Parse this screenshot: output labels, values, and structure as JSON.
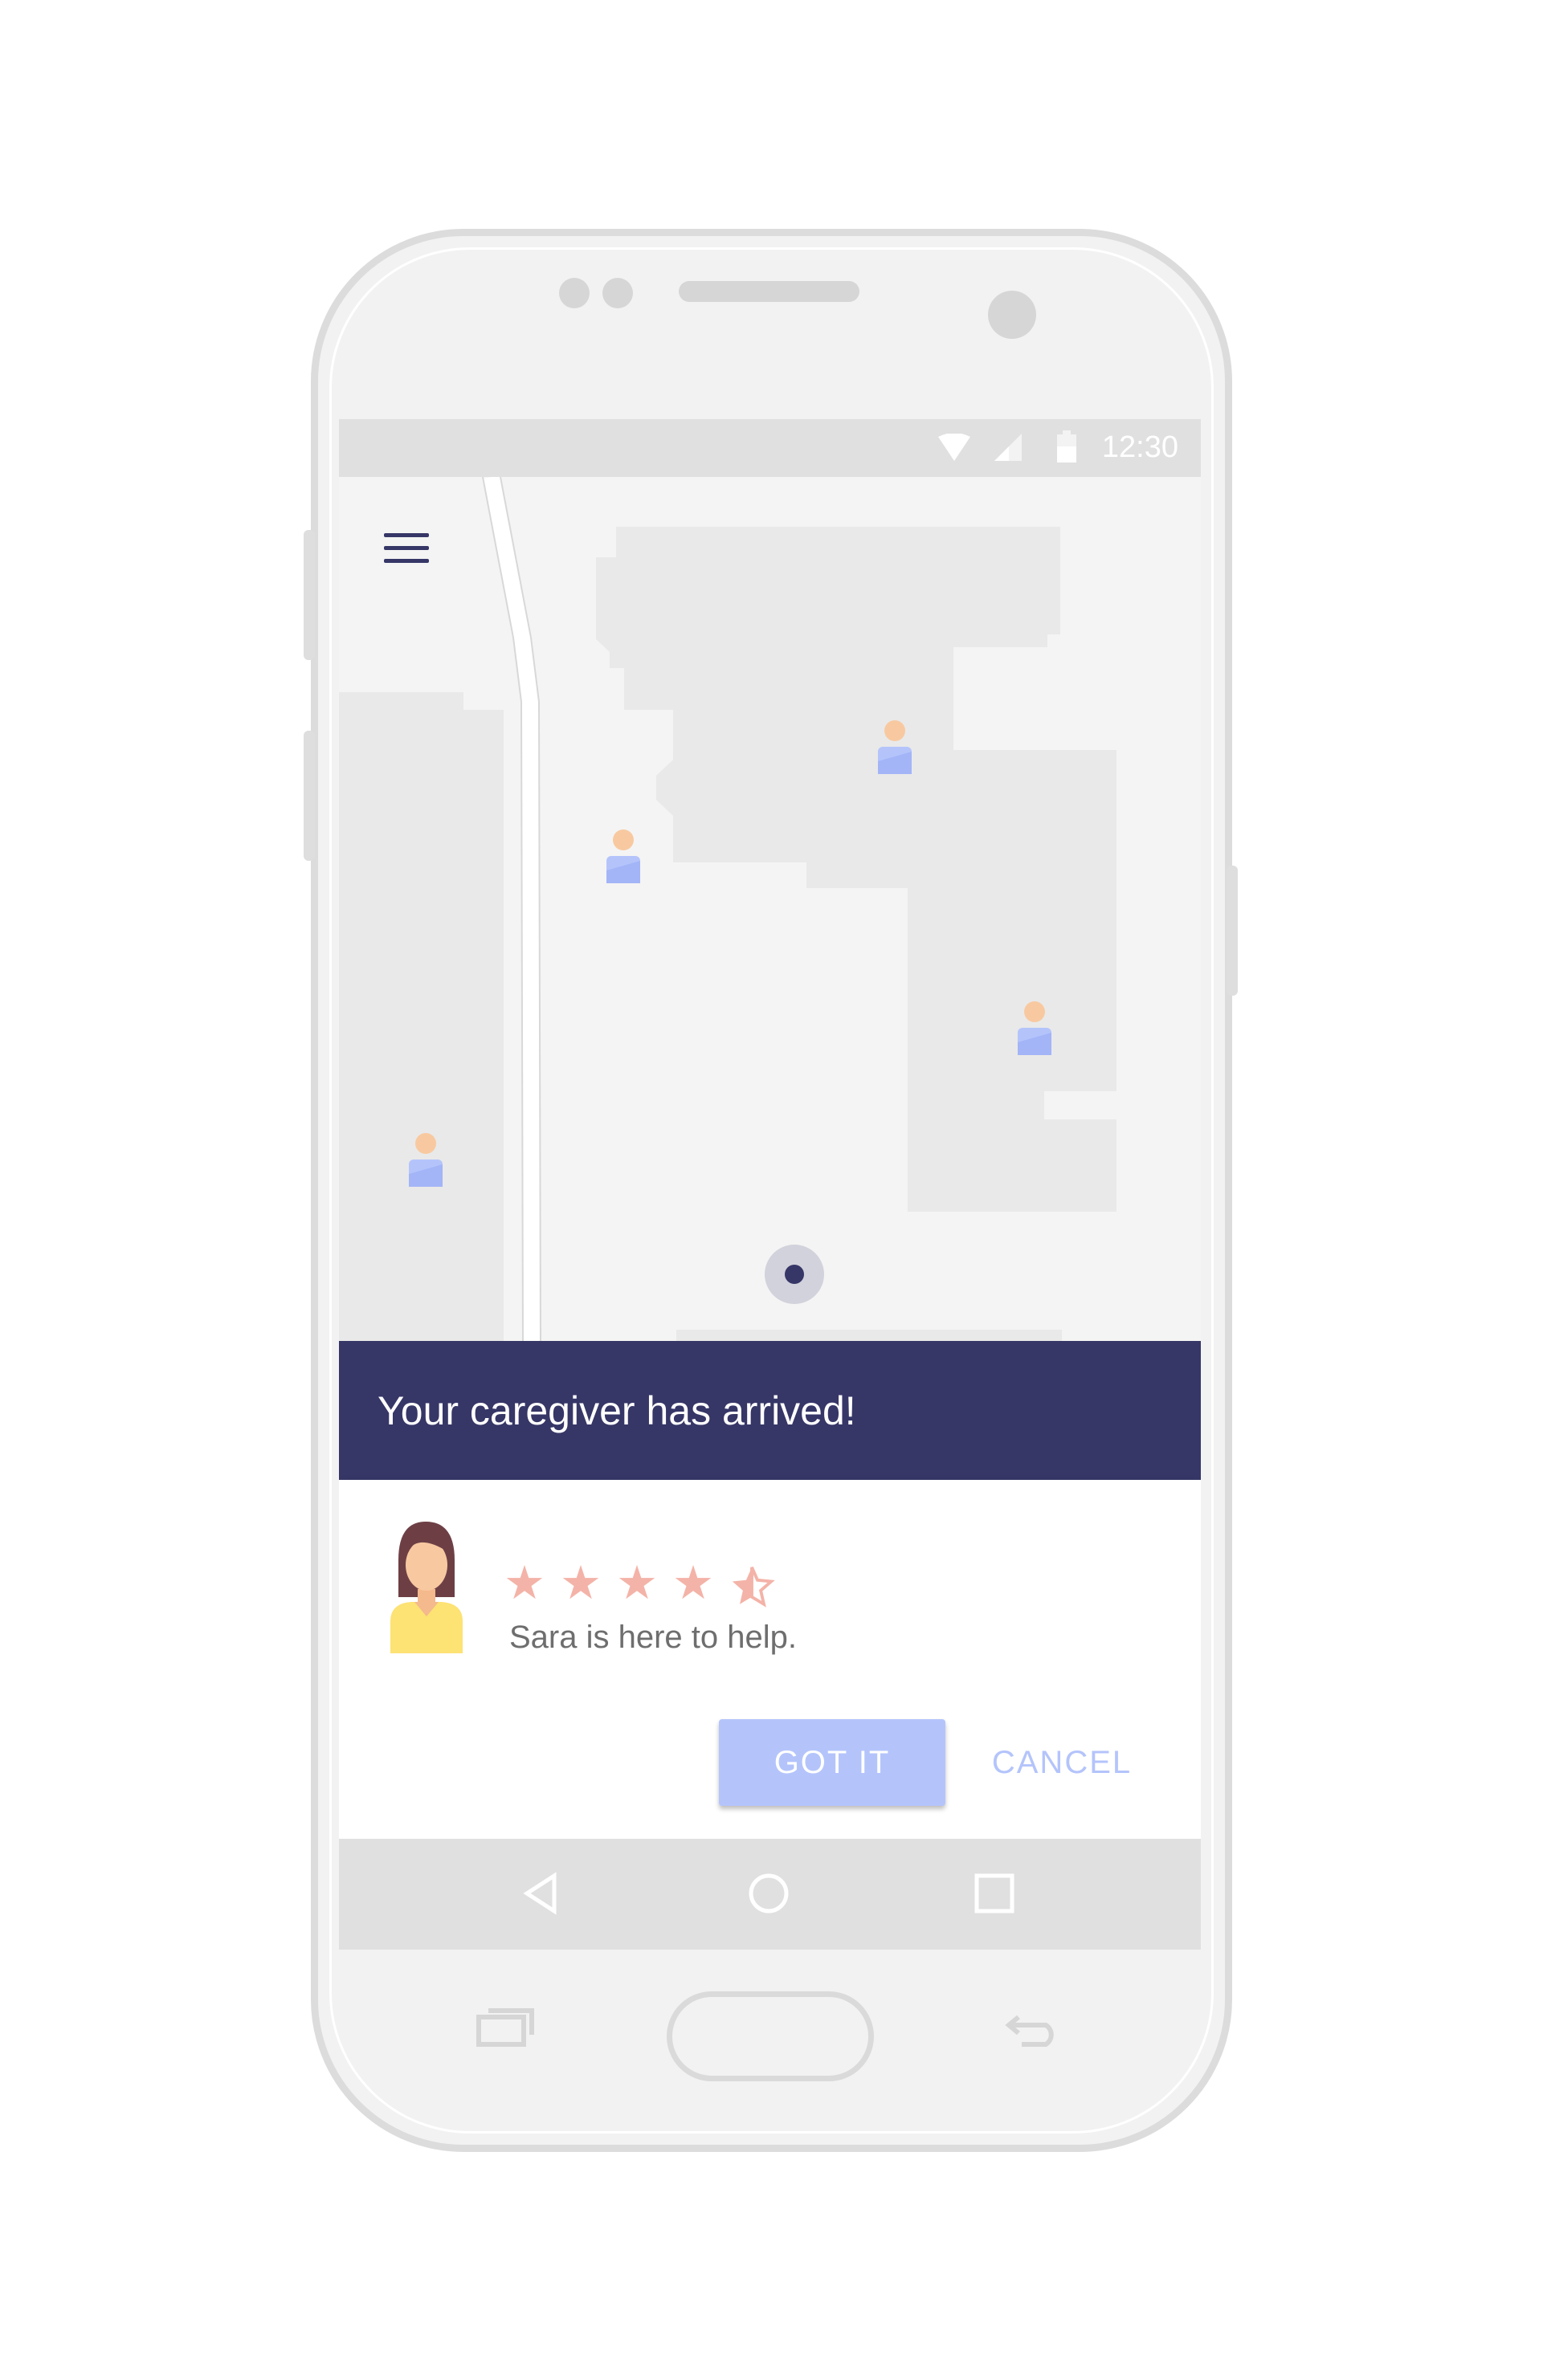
{
  "status_bar": {
    "time": "12:30",
    "icons": [
      "wifi-icon",
      "signal-icon",
      "battery-icon"
    ]
  },
  "map": {
    "menu_icon": "hamburger-menu-icon",
    "caregiver_pins": [
      "person-pin-icon",
      "person-pin-icon",
      "person-pin-icon",
      "person-pin-icon"
    ],
    "my_location_icon": "current-location-icon"
  },
  "banner": {
    "message": "Your caregiver has arrived!"
  },
  "caregiver_card": {
    "avatar_icon": "caregiver-avatar-icon",
    "rating": 4.5,
    "rating_max": 5,
    "message": "Sara is here to help.",
    "confirm_label": "GOT IT",
    "cancel_label": "CANCEL"
  },
  "nav_bar": {
    "icons": [
      "back-triangle-icon",
      "home-circle-icon",
      "recents-square-icon"
    ]
  },
  "colors": {
    "primary": "#363667",
    "accent": "#b4c4fb",
    "star": "#f4b3a8",
    "map_block": "#e9e9e9"
  }
}
